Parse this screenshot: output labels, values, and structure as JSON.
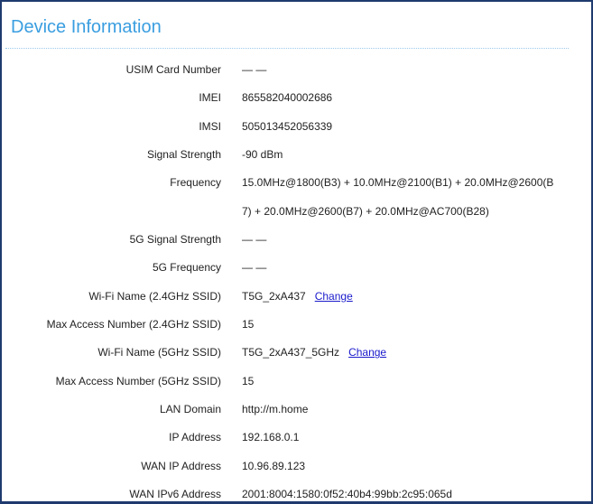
{
  "title": "Device Information",
  "rows": [
    {
      "label": "USIM Card Number",
      "value": "— —"
    },
    {
      "label": "IMEI",
      "value": "865582040002686"
    },
    {
      "label": "IMSI",
      "value": "505013452056339"
    },
    {
      "label": "Signal Strength",
      "value": "-90 dBm"
    },
    {
      "label": "Frequency",
      "value": "15.0MHz@1800(B3) + 10.0MHz@2100(B1) + 20.0MHz@2600(B",
      "value2": "7) + 20.0MHz@2600(B7) + 20.0MHz@AC700(B28)"
    },
    {
      "label": "5G Signal Strength",
      "value": "— —"
    },
    {
      "label": "5G Frequency",
      "value": "— —"
    },
    {
      "label": "Wi-Fi Name (2.4GHz SSID)",
      "value": "T5G_2xA437",
      "link": "Change"
    },
    {
      "label": "Max Access Number (2.4GHz SSID)",
      "value": "15"
    },
    {
      "label": "Wi-Fi Name (5GHz SSID)",
      "value": "T5G_2xA437_5GHz",
      "link": "Change"
    },
    {
      "label": "Max Access Number (5GHz SSID)",
      "value": "15"
    },
    {
      "label": "LAN Domain",
      "value": "http://m.home"
    },
    {
      "label": "IP Address",
      "value": "192.168.0.1"
    },
    {
      "label": "WAN IP Address",
      "value": "10.96.89.123"
    },
    {
      "label": "WAN IPv6 Address",
      "value": "2001:8004:1580:0f52:40b4:99bb:2c95:065d"
    }
  ],
  "colors": {
    "title": "#3a9ee0",
    "link": "#1a1acc",
    "border": "#1f3a6e"
  }
}
